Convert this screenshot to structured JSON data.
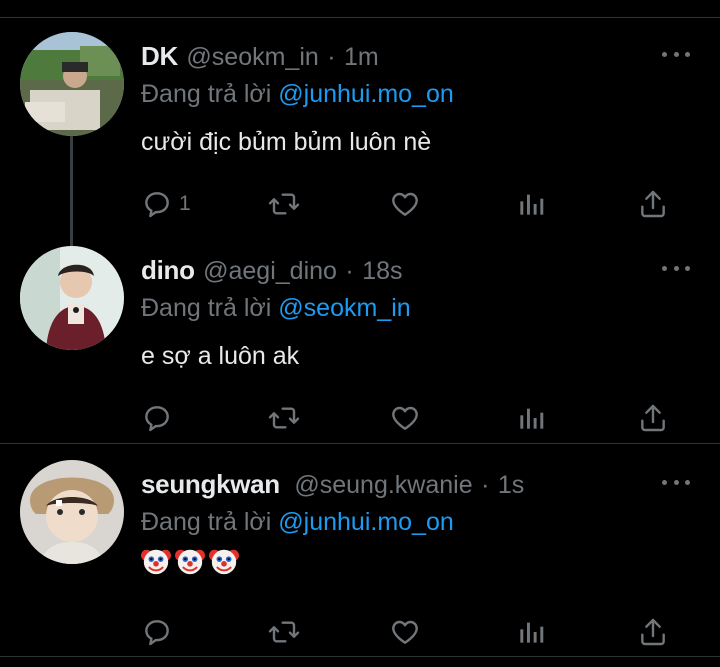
{
  "colors": {
    "background": "#000000",
    "text": "#e7e9ea",
    "muted": "#71767b",
    "link": "#1d9bf0",
    "divider": "#2f3336"
  },
  "icons": [
    "reply-icon",
    "retweet-icon",
    "like-icon",
    "views-icon",
    "share-icon",
    "more-icon",
    "clown-face-icon"
  ],
  "tweets": [
    {
      "display_name": "DK",
      "handle": "@seokm_in",
      "separator": "·",
      "time": "1m",
      "reply_prefix": "Đang trả lời ",
      "reply_to": "@junhui.mo_on",
      "text": "cười địc bủm bủm luôn nè",
      "reply_count": "1"
    },
    {
      "display_name": "dino",
      "handle": "@aegi_dino",
      "separator": "·",
      "time": "18s",
      "reply_prefix": "Đang trả lời ",
      "reply_to": "@seokm_in",
      "text": "e sợ a luôn ak",
      "reply_count": ""
    },
    {
      "display_name": "seungkwan",
      "handle": "@seung.kwanie",
      "separator": "·",
      "time": "1s",
      "reply_prefix": "Đang trả lời ",
      "reply_to": "@junhui.mo_on",
      "text": "",
      "reply_count": ""
    }
  ]
}
